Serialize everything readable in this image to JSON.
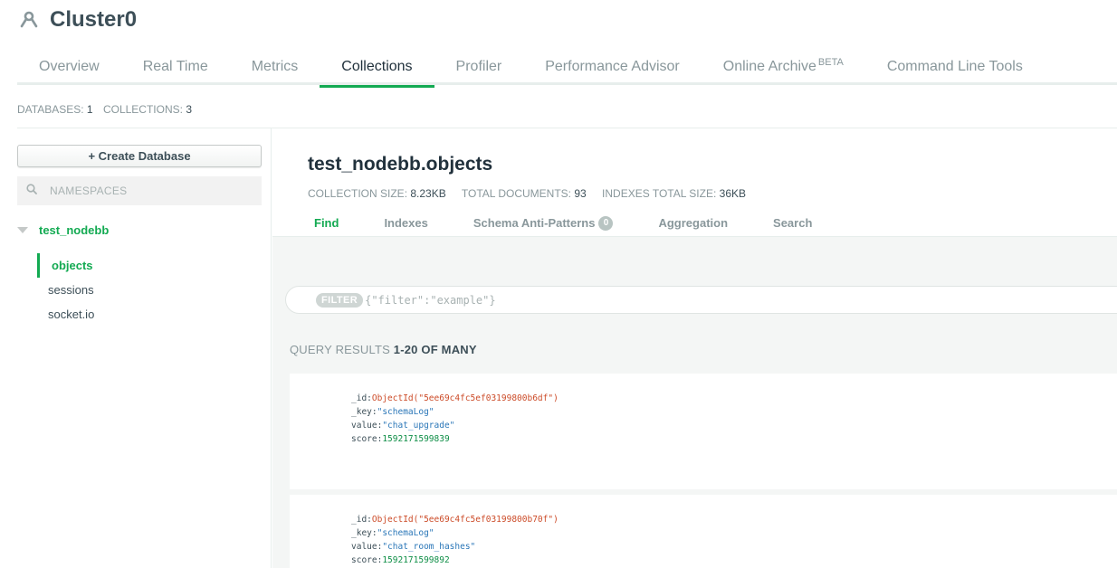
{
  "header": {
    "title": "Cluster0",
    "icon": "cluster-icon"
  },
  "tabs": [
    {
      "label": "Overview",
      "active": false
    },
    {
      "label": "Real Time",
      "active": false
    },
    {
      "label": "Metrics",
      "active": false
    },
    {
      "label": "Collections",
      "active": true
    },
    {
      "label": "Profiler",
      "active": false
    },
    {
      "label": "Performance Advisor",
      "active": false
    },
    {
      "label": "Online Archive",
      "badge": "BETA",
      "active": false
    },
    {
      "label": "Command Line Tools",
      "active": false
    }
  ],
  "counts": {
    "databases_label": "DATABASES:",
    "databases": "1",
    "collections_label": "COLLECTIONS:",
    "collections": "3"
  },
  "sidebar": {
    "create_button": "Create Database",
    "search_placeholder": "NAMESPACES",
    "database": "test_nodebb",
    "collections": [
      {
        "label": "objects",
        "active": true
      },
      {
        "label": "sessions",
        "active": false
      },
      {
        "label": "socket.io",
        "active": false
      }
    ]
  },
  "collection": {
    "title": "test_nodebb.objects",
    "size_label": "COLLECTION SIZE:",
    "size": "8.23KB",
    "docs_label": "TOTAL DOCUMENTS:",
    "docs": "93",
    "indexes_label": "INDEXES TOTAL SIZE:",
    "indexes": "36KB"
  },
  "subtabs": [
    {
      "label": "Find",
      "active": true
    },
    {
      "label": "Indexes",
      "active": false
    },
    {
      "label": "Schema Anti-Patterns",
      "badge": "0",
      "active": false
    },
    {
      "label": "Aggregation",
      "active": false
    },
    {
      "label": "Search",
      "active": false
    }
  ],
  "filter": {
    "pill": "FILTER",
    "placeholder": "{\"filter\":\"example\"}"
  },
  "results": {
    "label": "QUERY RESULTS",
    "range": "1-20 OF MANY"
  },
  "documents": [
    {
      "id_key": "_id:",
      "id": "ObjectId(\"5ee69c4fc5ef03199800b6df\")",
      "key_key": "_key:",
      "key": "\"schemaLog\"",
      "value_key": "value:",
      "value": "\"chat_upgrade\"",
      "score_key": "score:",
      "score": "1592171599839"
    },
    {
      "id_key": "_id:",
      "id": "ObjectId(\"5ee69c4fc5ef03199800b70f\")",
      "key_key": "_key:",
      "key": "\"schemaLog\"",
      "value_key": "value:",
      "value": "\"chat_room_hashes\"",
      "score_key": "score:",
      "score": "1592171599892"
    }
  ],
  "colors": {
    "accent": "#13aa52",
    "oid": "#cc4b28",
    "string": "#2b77b8",
    "number": "#0e8e46"
  }
}
